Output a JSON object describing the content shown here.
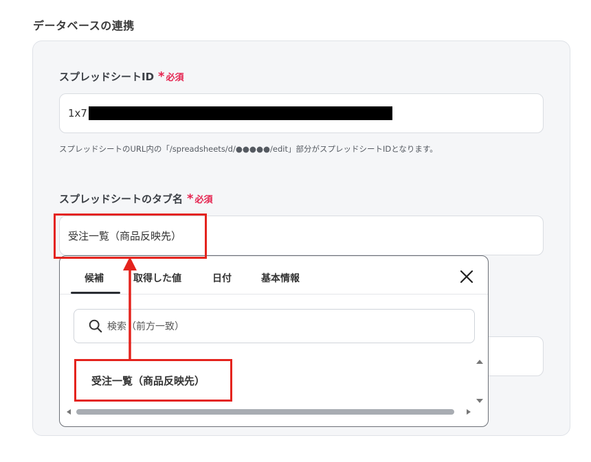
{
  "section": {
    "title": "データベースの連携"
  },
  "spreadsheet_id": {
    "label": "スプレッドシートID",
    "required_star": "*",
    "required_text": "必須",
    "value_prefix": "1x7",
    "hint": "スプレッドシートのURL内の「/spreadsheets/d/●●●●●/edit」部分がスプレッドシートIDとなります。"
  },
  "tab_name": {
    "label": "スプレッドシートのタブ名",
    "required_star": "*",
    "required_text": "必須",
    "value": "受注一覧（商品反映先）"
  },
  "dropdown": {
    "tabs": [
      "候補",
      "取得した値",
      "日付",
      "基本情報"
    ],
    "active_tab": "候補",
    "search_placeholder": "検索（前方一致）",
    "items": [
      "受注一覧（商品反映先）"
    ]
  },
  "colors": {
    "required": "#e5234f",
    "annotation": "#e4231d"
  }
}
